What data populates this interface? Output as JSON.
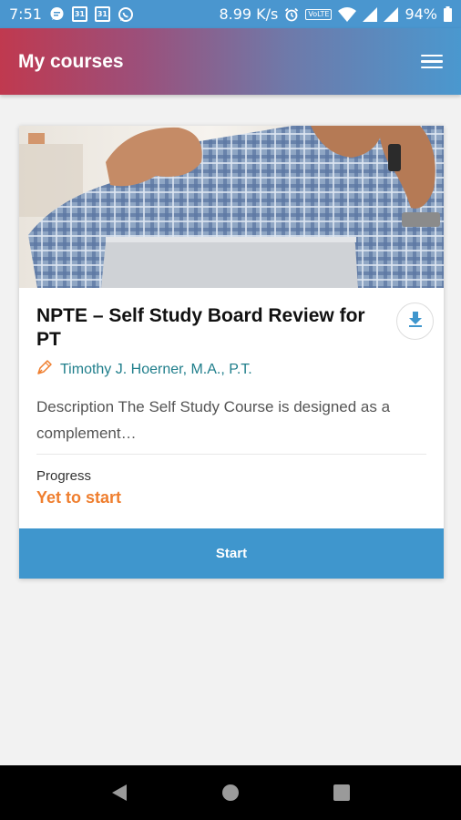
{
  "status_bar": {
    "time": "7:51",
    "net_speed": "8.99 K/s",
    "volte": "VoLTE",
    "battery": "94%",
    "calendar_day": "31",
    "icons": [
      "message-icon",
      "calendar-icon",
      "calendar-icon",
      "whatsapp-icon",
      "alarm-icon",
      "wifi-icon",
      "signal-icon",
      "battery-icon"
    ]
  },
  "app_bar": {
    "title": "My courses",
    "menu_icon": "hamburger-menu-icon"
  },
  "course": {
    "title": "NPTE – Self Study Board Review for PT",
    "author": "Timothy J. Hoerner, M.A., P.T.",
    "description": "Description The Self Study Course is designed as a complement…",
    "progress_label": "Progress",
    "progress_status": "Yet to start",
    "start_label": "Start",
    "download_icon": "download-icon",
    "author_icon": "pen-icon"
  },
  "colors": {
    "accent_blue": "#3f96cd",
    "app_bar_start": "#c0394f",
    "app_bar_end": "#4a98cf",
    "author_teal": "#1f7e8b",
    "progress_orange": "#ef7e2e"
  },
  "nav_bar": {
    "icons": [
      "back-icon",
      "home-icon",
      "recents-icon"
    ]
  }
}
